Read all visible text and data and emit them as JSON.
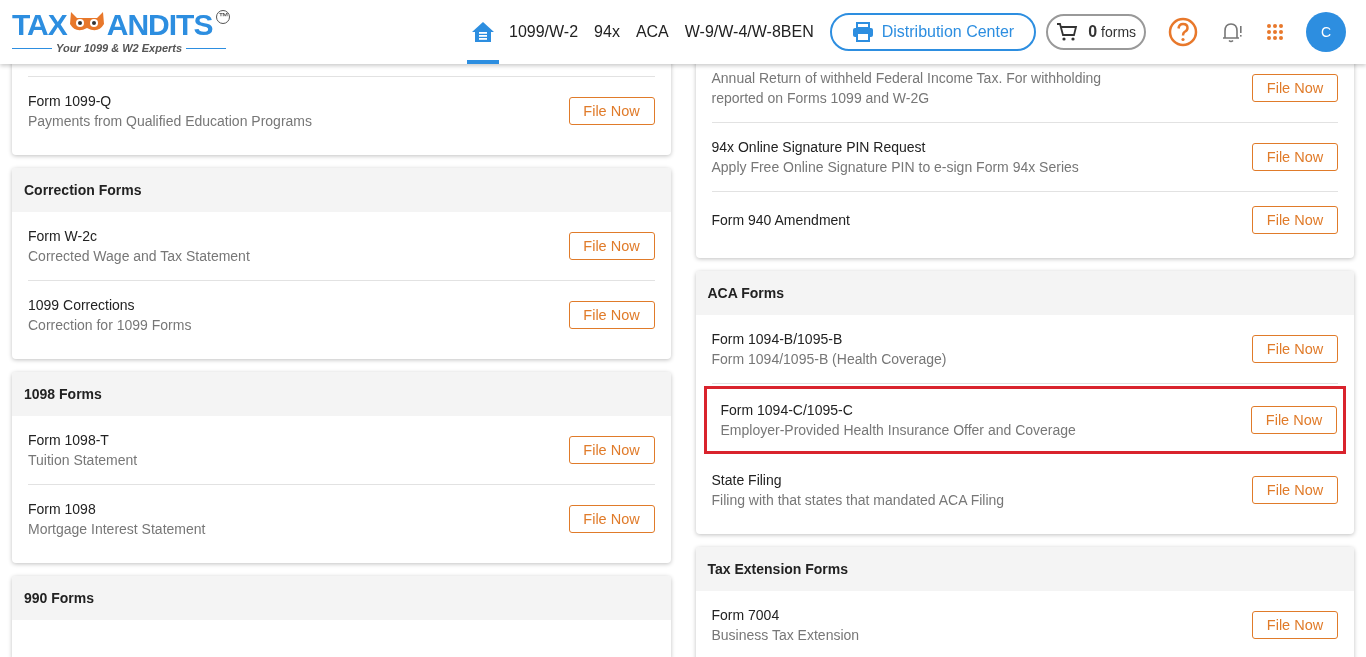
{
  "logo": {
    "left": "TAX",
    "right": "ANDITS",
    "mark": "™",
    "tagline": "Your 1099 & W2 Experts"
  },
  "nav": [
    {
      "kind": "home",
      "selected": true
    },
    {
      "kind": "text",
      "label": "1099/W-2",
      "selected": false
    },
    {
      "kind": "text",
      "label": "94x",
      "selected": false
    },
    {
      "kind": "text",
      "label": "ACA",
      "selected": false
    },
    {
      "kind": "text",
      "label": "W-9/W-4/W-8BEN",
      "selected": false
    }
  ],
  "distribution_button": "Distribution Center",
  "cart": {
    "count": "0",
    "unit": "forms"
  },
  "avatar": "C",
  "columns": [
    [
      {
        "rows": [
          {
            "title": "Form 1099-Q",
            "desc": "Payments from Qualified Education Programs",
            "button": "File Now",
            "highlighted": false
          }
        ]
      },
      {
        "title": "Correction Forms",
        "rows": [
          {
            "title": "Form W-2c",
            "desc": "Corrected Wage and Tax Statement",
            "button": "File Now",
            "highlighted": false
          },
          {
            "title": "1099 Corrections",
            "desc": "Correction for 1099 Forms",
            "button": "File Now",
            "highlighted": false
          }
        ]
      },
      {
        "title": "1098 Forms",
        "rows": [
          {
            "title": "Form 1098-T",
            "desc": "Tuition Statement",
            "button": "File Now",
            "highlighted": false
          },
          {
            "title": "Form 1098",
            "desc": "Mortgage Interest Statement",
            "button": "File Now",
            "highlighted": false
          }
        ]
      },
      {
        "title": "990 Forms"
      }
    ],
    [
      {
        "rows": [
          {
            "desc": "Annual Return of withheld Federal Income Tax. For withholding reported on Forms 1099 and W-2G",
            "button": "File Now",
            "highlighted": false
          },
          {
            "title": "94x Online Signature PIN Request",
            "desc": "Apply Free Online Signature PIN to e-sign Form 94x Series",
            "button": "File Now",
            "highlighted": false
          },
          {
            "title": "Form 940 Amendment",
            "button": "File Now",
            "highlighted": false
          }
        ]
      },
      {
        "title": "ACA Forms",
        "rows": [
          {
            "title": "Form 1094-B/1095-B",
            "desc": "Form 1094/1095-B (Health Coverage)",
            "button": "File Now",
            "highlighted": false
          },
          {
            "title": "Form 1094-C/1095-C",
            "desc": "Employer-Provided Health Insurance Offer and Coverage",
            "button": "File Now",
            "highlighted": true
          },
          {
            "title": "State Filing",
            "desc": "Filing with that states that mandated ACA Filing",
            "button": "File Now",
            "highlighted": false
          }
        ]
      },
      {
        "title": "Tax Extension Forms",
        "rows": [
          {
            "title": "Form 7004",
            "desc": "Business Tax Extension",
            "button": "File Now",
            "highlighted": false
          }
        ]
      }
    ]
  ]
}
